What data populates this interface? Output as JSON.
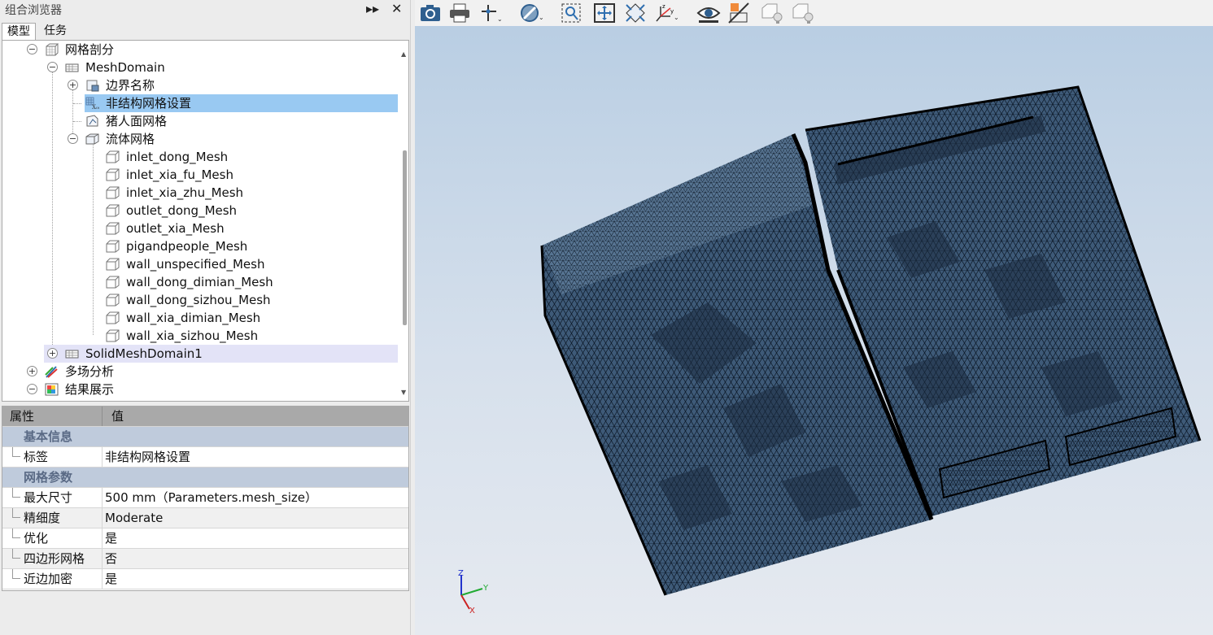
{
  "panel": {
    "title": "组合浏览器",
    "tabs": [
      "模型",
      "任务"
    ]
  },
  "tree": {
    "mesh_root": "网格剖分",
    "mesh_domain": "MeshDomain",
    "boundary_names": "边界名称",
    "unstructured_settings": "非结构网格设置",
    "pig_face_mesh": "猪人面网格",
    "fluid_mesh": "流体网格",
    "fluid_items": [
      "inlet_dong_Mesh",
      "inlet_xia_fu_Mesh",
      "inlet_xia_zhu_Mesh",
      "outlet_dong_Mesh",
      "outlet_xia_Mesh",
      "pigandpeople_Mesh",
      "wall_unspecified_Mesh",
      "wall_dong_dimian_Mesh",
      "wall_dong_sizhou_Mesh",
      "wall_xia_dimian_Mesh",
      "wall_xia_sizhou_Mesh"
    ],
    "solid_domain": "SolidMeshDomain1",
    "multiphysics": "多场分析",
    "results": "结果展示"
  },
  "props": {
    "col_property": "属性",
    "col_value": "值",
    "cat_basic": "基本信息",
    "label_key": "标签",
    "label_val": "非结构网格设置",
    "cat_mesh": "网格参数",
    "max_size_key": "最大尺寸",
    "max_size_val": "500 mm（Parameters.mesh_size）",
    "fineness_key": "精细度",
    "fineness_val": "Moderate",
    "optimize_key": "优化",
    "optimize_val": "是",
    "quad_key": "四边形网格",
    "quad_val": "否",
    "refine_key": "近边加密",
    "refine_val": "是"
  },
  "axes": {
    "z": "Z",
    "y": "Y",
    "x": "X"
  },
  "colors": {
    "selection": "#99c9f2",
    "mesh_fill": "#3e5a78",
    "view_bg_top": "#b9cee3"
  }
}
